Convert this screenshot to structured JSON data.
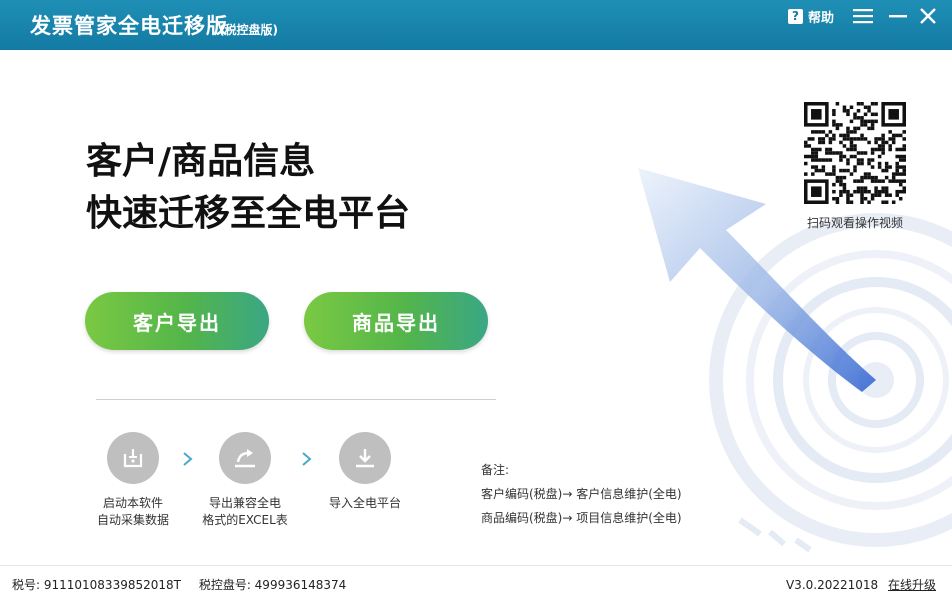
{
  "window": {
    "title": "发票管家全电迁移版",
    "subtitle": "(税控盘版)",
    "help_label": "帮助",
    "help_glyph": "?"
  },
  "main": {
    "headline_line1": "客户/商品信息",
    "headline_line2": "快速迁移至全电平台",
    "qr_caption": "扫码观看操作视频",
    "buttons": {
      "customer_export": "客户导出",
      "product_export": "商品导出"
    },
    "steps": [
      {
        "line1": "启动本软件",
        "line2": "自动采集数据",
        "icon": "start-app-icon"
      },
      {
        "line1": "导出兼容全电",
        "line2": "格式的EXCEL表",
        "icon": "export-share-icon"
      },
      {
        "line1": "导入全电平台",
        "line2": "",
        "icon": "import-download-icon"
      }
    ],
    "notes": {
      "heading": "备注:",
      "line1": "客户编码(税盘)→ 客户信息维护(全电)",
      "line2": "商品编码(税盘)→ 项目信息维护(全电)"
    }
  },
  "status": {
    "tax_id": "税号: 91110108339852018T",
    "disk_id": "税控盘号: 499936148374",
    "version": "V3.0.20221018",
    "upgrade_label": "在线升级"
  },
  "colors": {
    "titlebar": "#137aa3",
    "button_start": "#7ac943",
    "button_end": "#3aa785",
    "step_circle": "#bfbfbf"
  }
}
